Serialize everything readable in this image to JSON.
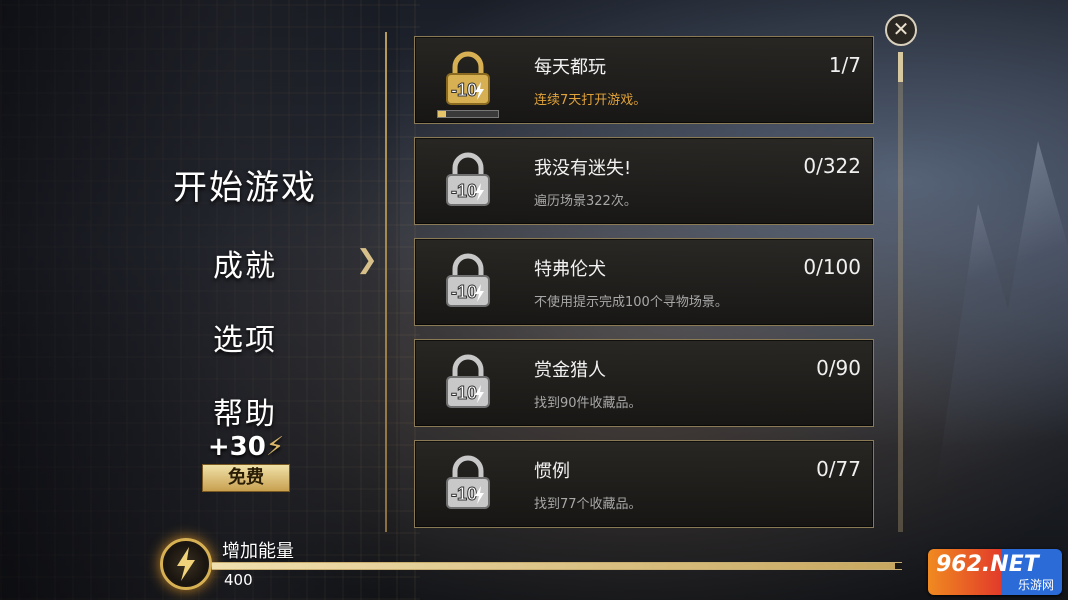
{
  "menu": {
    "items": [
      {
        "label": "开始游戏"
      },
      {
        "label": "成就"
      },
      {
        "label": "选项"
      },
      {
        "label": "帮助"
      }
    ],
    "bonus_amount": "+30",
    "free_label": "免费"
  },
  "achievements": [
    {
      "title": "每天都玩",
      "desc": "连续7天打开游戏。",
      "progress": "1/7",
      "reward": "10",
      "progress_fraction": 0.14,
      "active": true
    },
    {
      "title": "我没有迷失!",
      "desc": "遍历场景322次。",
      "progress": "0/322",
      "reward": "10",
      "active": false
    },
    {
      "title": "特弗伦犬",
      "desc": "不使用提示完成100个寻物场景。",
      "progress": "0/100",
      "reward": "10",
      "active": false
    },
    {
      "title": "赏金猎人",
      "desc": "找到90件收藏品。",
      "progress": "0/90",
      "reward": "10",
      "active": false
    },
    {
      "title": "惯例",
      "desc": "找到77个收藏品。",
      "progress": "0/77",
      "reward": "10",
      "active": false
    }
  ],
  "energy": {
    "label": "增加能量",
    "value": "400",
    "fill_fraction": 0.99
  },
  "watermark": {
    "logo": "962.NET",
    "sub": "乐游网"
  },
  "colors": {
    "gold": "#d8b66a",
    "active_desc": "#e0a23a"
  }
}
